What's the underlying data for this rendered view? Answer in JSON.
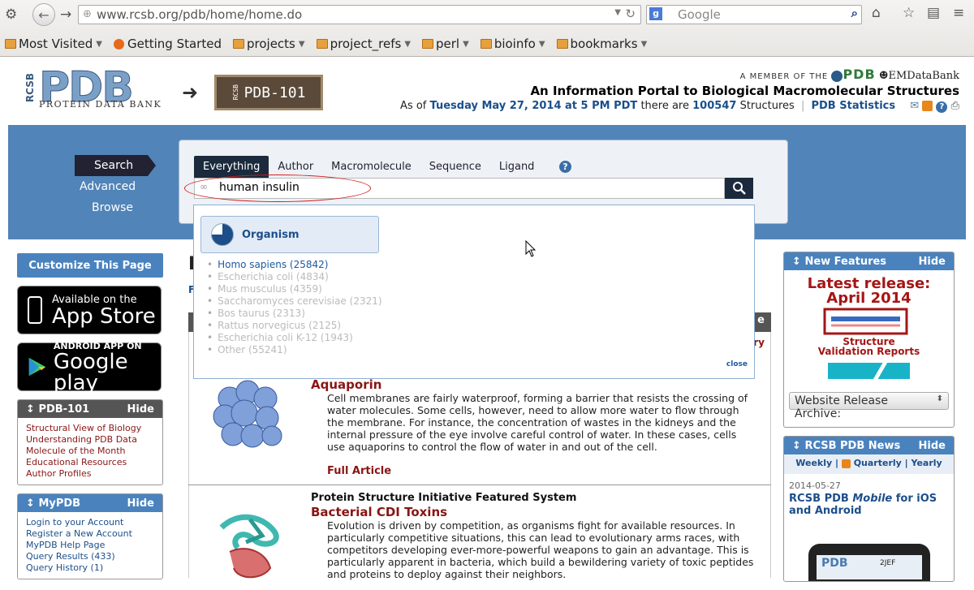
{
  "browser": {
    "url": "www.rcsb.org/pdb/home/home.do",
    "search_placeholder": "Google",
    "bookmarks": [
      "Most Visited",
      "Getting Started",
      "projects",
      "project_refs",
      "perl",
      "bioinfo",
      "bookmarks"
    ]
  },
  "header": {
    "member_prefix": "A MEMBER OF THE",
    "member_org": "PDB",
    "emdb": "EMDataBank",
    "tagline": "An Information Portal to Biological Macromolecular Structures",
    "asof_prefix": "As of",
    "asof_date": "Tuesday May 27, 2014 at 5 PM PDT",
    "asof_mid": "there are",
    "structure_count": "100547",
    "asof_suffix": "Structures",
    "stats_link": "PDB Statistics",
    "logo_rcsb": "RCSB",
    "logo_pdb": "PDB",
    "logo_sub": "PROTEIN DATA BANK",
    "pdb101": "PDB-101"
  },
  "search": {
    "nav": [
      "Search",
      "Advanced",
      "Browse"
    ],
    "tabs": [
      "Everything",
      "Author",
      "Macromolecule",
      "Sequence",
      "Ligand"
    ],
    "help": "?",
    "query": "human insulin"
  },
  "dropdown": {
    "category": "Organism",
    "items": [
      "Homo sapiens (25842)",
      "Escherichia coli (4834)",
      "Mus musculus (4359)",
      "Saccharomyces cerevisiae (2321)",
      "Bos taurus (2313)",
      "Rattus norvegicus (2125)",
      "Escherichia coli K-12 (1943)",
      "Other (55241)"
    ],
    "close": "close"
  },
  "left": {
    "customize": "Customize This Page",
    "appstore_small": "Available on the",
    "appstore_big": "App Store",
    "google_small": "ANDROID APP ON",
    "google_big": "Google play",
    "pdb101_panel": {
      "title": "PDB-101",
      "hide": "Hide",
      "links": [
        "Structural View of Biology",
        "Understanding PDB Data",
        "Molecule of the Month",
        "Educational Resources",
        "Author Profiles"
      ]
    },
    "mypdb_panel": {
      "title": "MyPDB",
      "hide": "Hide",
      "links": [
        "Login to your Account",
        "Register a New Account",
        "MyPDB Help Page",
        "Query Results (433)",
        "Query History (1)"
      ]
    }
  },
  "center": {
    "heading_partial": "I",
    "sub_partial": "F",
    "bar_partial": "e",
    "ry_partial": "ry",
    "feature1": {
      "title": "Aquaporin",
      "text": "Cell membranes are fairly waterproof, forming a barrier that resists the crossing of water molecules. Some cells, however, need to allow more water to flow through the membrane. For instance, the concentration of wastes in the kidneys and the internal pressure of the eye involve careful control of water. In these cases, cells use aquaporins to control the flow of water in and out of the cell.",
      "more": "Full Article"
    },
    "feature2": {
      "subtitle": "Protein Structure Initiative Featured System",
      "title": "Bacterial CDI Toxins",
      "text": "Evolution is driven by competition, as organisms fight for available resources. In particularly competitive situations, this can lead to evolutionary arms races, with competitors developing ever-more-powerful weapons to gain an advantage. This is particularly apparent in bacteria, which build a bewildering variety of toxic peptides and proteins to deploy against their neighbors."
    }
  },
  "right": {
    "features_panel": {
      "title": "New Features",
      "hide": "Hide",
      "latest_line1": "Latest release:",
      "latest_line2": "April 2014",
      "validation": "Structure Validation Reports",
      "archive": "Website Release Archive:"
    },
    "news_panel": {
      "title": "RCSB PDB News",
      "hide": "Hide",
      "weekly": "Weekly",
      "quarterly": "Quarterly",
      "yearly": "Yearly",
      "date": "2014-05-27",
      "headline_a": "RCSB PDB ",
      "headline_b": "Mobile",
      "headline_c": " for iOS and Android",
      "phone_label": "2JEF"
    }
  }
}
